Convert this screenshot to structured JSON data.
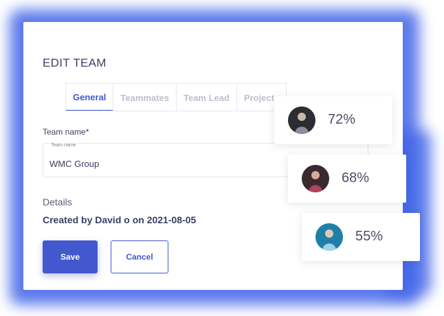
{
  "dialog": {
    "title": "EDIT TEAM",
    "tabs": [
      {
        "label": "General",
        "active": true
      },
      {
        "label": "Teammates",
        "active": false
      },
      {
        "label": "Team Lead",
        "active": false
      },
      {
        "label": "Projects",
        "active": false
      }
    ],
    "team_name_label": "Team name*",
    "team_name_input": {
      "floating_label": "Team name",
      "value": "WMC Group"
    },
    "details_label": "Details",
    "created_text": "Created by David o on 2021-08-05",
    "save_label": "Save",
    "cancel_label": "Cancel"
  },
  "stats": [
    {
      "percent": "72%",
      "avatar": "avatar-person-1"
    },
    {
      "percent": "68%",
      "avatar": "avatar-person-2"
    },
    {
      "percent": "55%",
      "avatar": "avatar-person-3"
    }
  ],
  "colors": {
    "accent": "#4358cf",
    "glow": "#3f63e8",
    "text": "#3a3f63",
    "muted_tab": "#bcc0cc"
  }
}
